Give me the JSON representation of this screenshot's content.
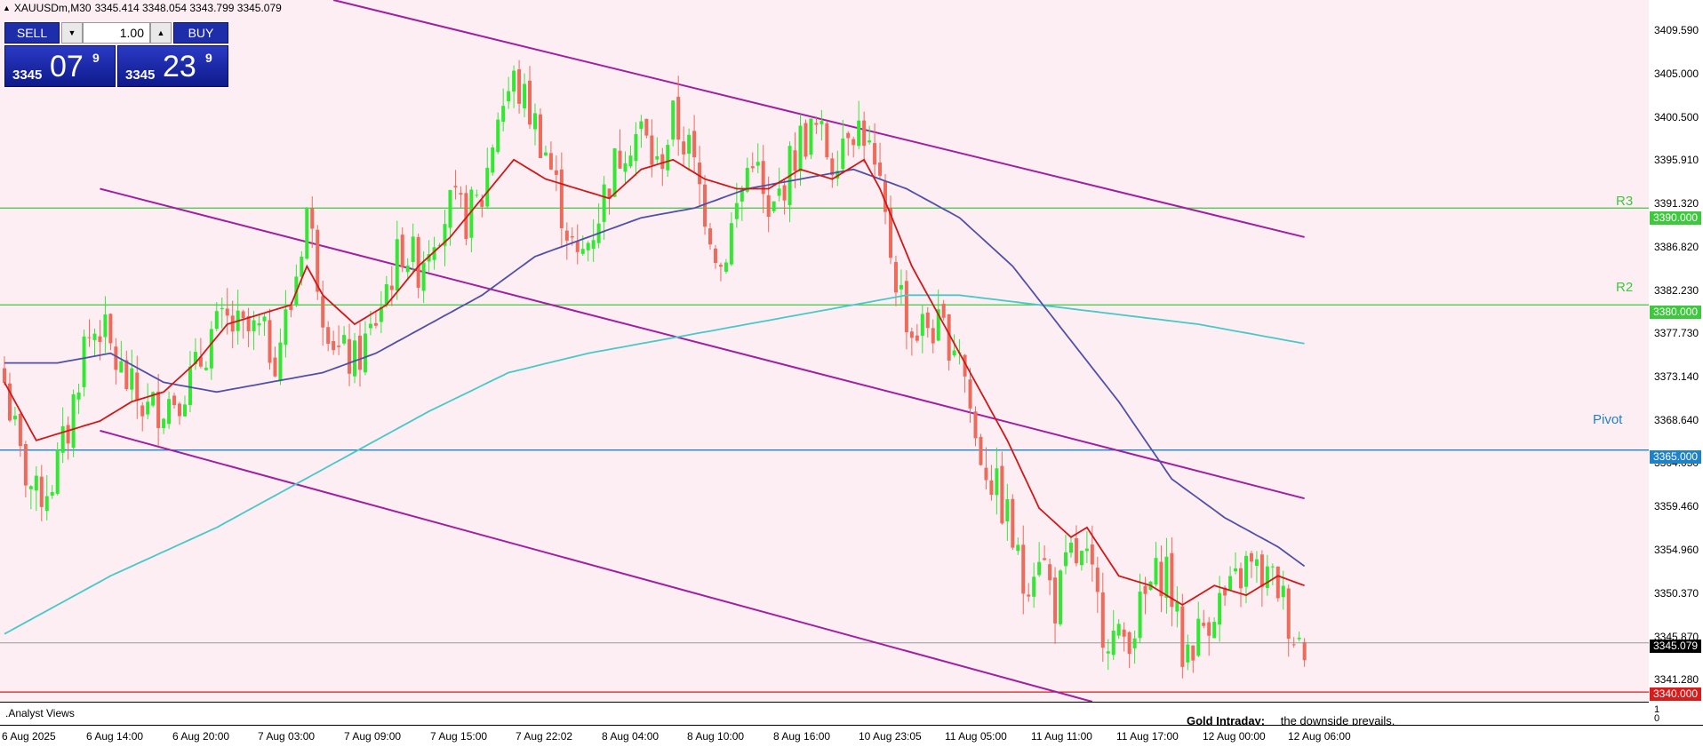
{
  "header": {
    "symbol": "XAUUSDm,M30",
    "ohlc": "3345.414 3348.054 3343.799 3345.079"
  },
  "trade_panel": {
    "sell_label": "SELL",
    "buy_label": "BUY",
    "lot": "1.00",
    "bid": {
      "small": "3345",
      "big": "07",
      "sup": "9"
    },
    "ask": {
      "small": "3345",
      "big": "23",
      "sup": "9"
    }
  },
  "levels": [
    {
      "name": "R3",
      "price": 3390.0,
      "price_label": "3390.000",
      "color": "#3ec83e"
    },
    {
      "name": "R2",
      "price": 3380.0,
      "price_label": "3380.000",
      "color": "#3ec83e"
    },
    {
      "name": "Pivot",
      "price": 3365.0,
      "price_label": "3365.000",
      "color": "#1e82c8"
    },
    {
      "name": "",
      "price": 3340.0,
      "price_label": "3340.000",
      "color": "#d81c1c"
    }
  ],
  "current_price": {
    "value": 3345.079,
    "label": "3345.079"
  },
  "price_ticks": [
    "3409.590",
    "3405.000",
    "3400.500",
    "3395.910",
    "3391.320",
    "3386.820",
    "3382.230",
    "3377.730",
    "3373.140",
    "3368.640",
    "3364.050",
    "3359.460",
    "3354.960",
    "3350.370",
    "3345.870",
    "3341.280"
  ],
  "subwindow": {
    "title": ".Analyst Views",
    "gold_title": "Gold Intraday:",
    "gold_text": "the downside prevails.",
    "scale_top": "1",
    "scale_bottom": "0"
  },
  "time_labels": [
    "6 Aug 2025",
    "6 Aug 14:00",
    "6 Aug 20:00",
    "7 Aug 03:00",
    "7 Aug 09:00",
    "7 Aug 15:00",
    "7 Aug 22:02",
    "8 Aug 04:00",
    "8 Aug 10:00",
    "8 Aug 16:00",
    "10 Aug 23:05",
    "11 Aug 05:00",
    "11 Aug 11:00",
    "11 Aug 17:00",
    "12 Aug 00:00",
    "12 Aug 06:00"
  ],
  "colors": {
    "background": "#fdeef4",
    "bull_candle": "#33e833",
    "bear_candle": "#ee6a5a",
    "channel": "#a020a0",
    "ma_fast": "#d01818",
    "ma_mid": "#5050a8",
    "ma_slow": "#48c8c8"
  },
  "chart_data": {
    "type": "candlestick",
    "symbol": "XAUUSDm",
    "timeframe": "M30",
    "ylim": [
      3339.0,
      3411.5
    ],
    "anchors_close": [
      [
        0,
        3372
      ],
      [
        3,
        3364
      ],
      [
        6,
        3360
      ],
      [
        9,
        3362
      ],
      [
        12,
        3367
      ],
      [
        15,
        3376
      ],
      [
        18,
        3378
      ],
      [
        21,
        3374
      ],
      [
        24,
        3371
      ],
      [
        27,
        3369
      ],
      [
        30,
        3370
      ],
      [
        33,
        3371
      ],
      [
        36,
        3373
      ],
      [
        39,
        3377
      ],
      [
        42,
        3378
      ],
      [
        45,
        3377
      ],
      [
        48,
        3377
      ],
      [
        51,
        3375
      ],
      [
        54,
        3380
      ],
      [
        57,
        3390
      ],
      [
        60,
        3380
      ],
      [
        63,
        3375
      ],
      [
        66,
        3374
      ],
      [
        69,
        3377
      ],
      [
        72,
        3382
      ],
      [
        75,
        3386
      ],
      [
        78,
        3384
      ],
      [
        81,
        3388
      ],
      [
        84,
        3390
      ],
      [
        87,
        3389
      ],
      [
        90,
        3391
      ],
      [
        93,
        3400
      ],
      [
        96,
        3403
      ],
      [
        99,
        3400
      ],
      [
        102,
        3396
      ],
      [
        105,
        3390
      ],
      [
        108,
        3384
      ],
      [
        111,
        3388
      ],
      [
        114,
        3393
      ],
      [
        117,
        3397
      ],
      [
        120,
        3398
      ],
      [
        123,
        3394
      ],
      [
        126,
        3399
      ],
      [
        129,
        3396
      ],
      [
        132,
        3390
      ],
      [
        135,
        3384
      ],
      [
        138,
        3390
      ],
      [
        141,
        3396
      ],
      [
        144,
        3388
      ],
      [
        147,
        3393
      ],
      [
        150,
        3397
      ],
      [
        153,
        3398
      ],
      [
        156,
        3395
      ],
      [
        159,
        3399
      ],
      [
        162,
        3398
      ],
      [
        165,
        3391
      ],
      [
        168,
        3383
      ],
      [
        171,
        3377
      ],
      [
        174,
        3378
      ],
      [
        177,
        3377
      ],
      [
        180,
        3376
      ],
      [
        183,
        3366
      ],
      [
        186,
        3362
      ],
      [
        189,
        3358
      ],
      [
        192,
        3351
      ],
      [
        195,
        3355
      ],
      [
        198,
        3349
      ],
      [
        201,
        3354
      ],
      [
        204,
        3353
      ],
      [
        207,
        3347
      ],
      [
        210,
        3345
      ],
      [
        213,
        3347
      ],
      [
        216,
        3351
      ],
      [
        219,
        3353
      ],
      [
        222,
        3344
      ],
      [
        225,
        3346
      ],
      [
        228,
        3349
      ],
      [
        231,
        3350
      ],
      [
        234,
        3353
      ],
      [
        237,
        3352
      ],
      [
        240,
        3351
      ],
      [
        243,
        3346
      ],
      [
        245,
        3345
      ]
    ],
    "ma_fast_anchors": [
      [
        0,
        3372
      ],
      [
        6,
        3366
      ],
      [
        12,
        3367
      ],
      [
        18,
        3368
      ],
      [
        24,
        3370
      ],
      [
        30,
        3371
      ],
      [
        36,
        3374
      ],
      [
        42,
        3378
      ],
      [
        48,
        3379
      ],
      [
        54,
        3380
      ],
      [
        57,
        3384
      ],
      [
        60,
        3381
      ],
      [
        66,
        3378
      ],
      [
        72,
        3380
      ],
      [
        78,
        3384
      ],
      [
        84,
        3387
      ],
      [
        90,
        3391
      ],
      [
        96,
        3395
      ],
      [
        102,
        3393
      ],
      [
        108,
        3392
      ],
      [
        114,
        3391
      ],
      [
        120,
        3394
      ],
      [
        126,
        3395
      ],
      [
        132,
        3393
      ],
      [
        138,
        3392
      ],
      [
        144,
        3392
      ],
      [
        150,
        3394
      ],
      [
        156,
        3393
      ],
      [
        162,
        3395
      ],
      [
        165,
        3392
      ],
      [
        171,
        3384
      ],
      [
        177,
        3378
      ],
      [
        183,
        3372
      ],
      [
        189,
        3366
      ],
      [
        195,
        3359
      ],
      [
        201,
        3356
      ],
      [
        204,
        3357
      ],
      [
        210,
        3352
      ],
      [
        216,
        3351
      ],
      [
        222,
        3349
      ],
      [
        228,
        3351
      ],
      [
        234,
        3350
      ],
      [
        240,
        3352
      ],
      [
        245,
        3351
      ]
    ],
    "ma_mid_anchors": [
      [
        0,
        3374
      ],
      [
        10,
        3374
      ],
      [
        20,
        3375
      ],
      [
        30,
        3372
      ],
      [
        40,
        3371
      ],
      [
        50,
        3372
      ],
      [
        60,
        3373
      ],
      [
        70,
        3375
      ],
      [
        80,
        3378
      ],
      [
        90,
        3381
      ],
      [
        100,
        3385
      ],
      [
        110,
        3387
      ],
      [
        120,
        3389
      ],
      [
        130,
        3390
      ],
      [
        140,
        3392
      ],
      [
        150,
        3393
      ],
      [
        160,
        3394
      ],
      [
        165,
        3393
      ],
      [
        170,
        3392
      ],
      [
        180,
        3389
      ],
      [
        190,
        3384
      ],
      [
        200,
        3377
      ],
      [
        210,
        3370
      ],
      [
        220,
        3362
      ],
      [
        230,
        3358
      ],
      [
        240,
        3355
      ],
      [
        245,
        3353
      ]
    ],
    "ma_slow_anchors": [
      [
        0,
        3346
      ],
      [
        20,
        3352
      ],
      [
        40,
        3357
      ],
      [
        60,
        3363
      ],
      [
        80,
        3369
      ],
      [
        95,
        3373
      ],
      [
        110,
        3375
      ],
      [
        130,
        3377
      ],
      [
        150,
        3379
      ],
      [
        160,
        3380
      ],
      [
        170,
        3381
      ],
      [
        180,
        3381
      ],
      [
        195,
        3380
      ],
      [
        210,
        3379
      ],
      [
        225,
        3378
      ],
      [
        245,
        3376
      ]
    ],
    "channel_lines": [
      {
        "from": [
          62,
          3411.5
        ],
        "to": [
          245,
          3387
        ]
      },
      {
        "from": [
          18,
          3392
        ],
        "to": [
          245,
          3360
        ]
      },
      {
        "from": [
          18,
          3367
        ],
        "to": [
          205,
          3339
        ]
      }
    ]
  }
}
